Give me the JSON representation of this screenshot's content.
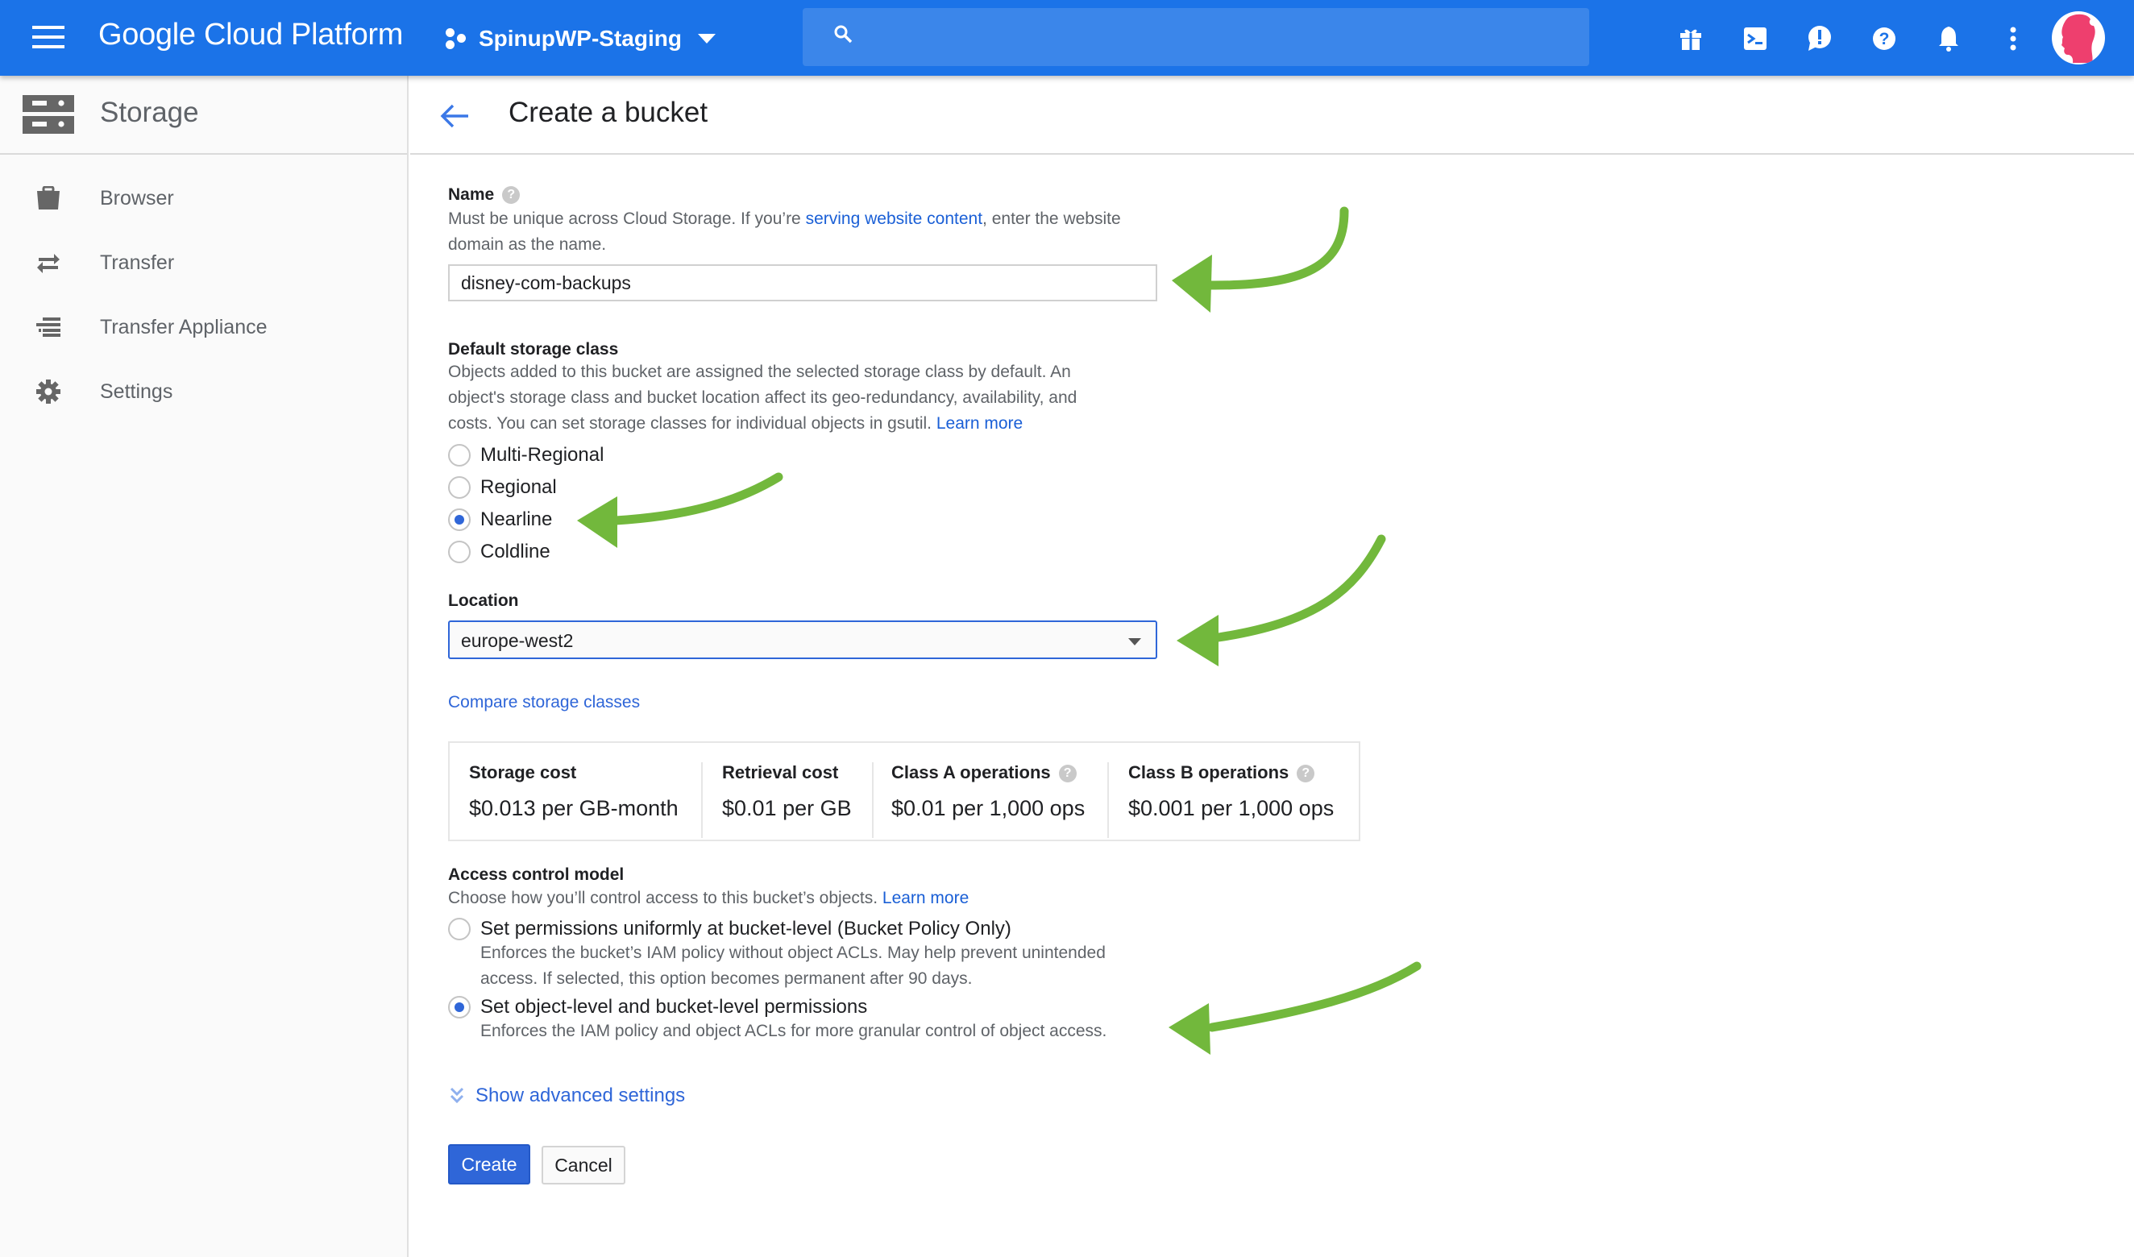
{
  "topbar": {
    "brand": "Google Cloud Platform",
    "project": "SpinupWP-Staging",
    "search_placeholder": "",
    "icons": [
      "gift-icon",
      "cloud-shell-icon",
      "feedback-icon",
      "help-icon",
      "notifications-icon",
      "more-vert-icon"
    ]
  },
  "sidebar": {
    "title": "Storage",
    "items": [
      {
        "label": "Browser",
        "icon": "bucket-icon"
      },
      {
        "label": "Transfer",
        "icon": "swap-arrows-icon"
      },
      {
        "label": "Transfer Appliance",
        "icon": "list-icon"
      },
      {
        "label": "Settings",
        "icon": "gear-icon"
      }
    ]
  },
  "header": {
    "title": "Create a bucket"
  },
  "form": {
    "name": {
      "label": "Name",
      "desc_pre": "Must be unique across Cloud Storage. If you’re ",
      "desc_link": "serving website content",
      "desc_post": ", enter the website",
      "desc_line2": "domain as the name.",
      "value": "disney-com-backups"
    },
    "storage_class": {
      "label": "Default storage class",
      "desc_line1": "Objects added to this bucket are assigned the selected storage class by default. An",
      "desc_line2": "object's storage class and bucket location affect its geo-redundancy, availability, and",
      "desc_line3": "costs. You can set storage classes for individual objects in gsutil. ",
      "learn_more": "Learn more",
      "options": [
        "Multi-Regional",
        "Regional",
        "Nearline",
        "Coldline"
      ],
      "selected": "Nearline"
    },
    "location": {
      "label": "Location",
      "value": "europe-west2"
    },
    "compare_link": "Compare storage classes",
    "pricing": [
      {
        "header": "Storage cost",
        "value": "$0.013 per GB-month",
        "help": false
      },
      {
        "header": "Retrieval cost",
        "value": "$0.01 per GB",
        "help": false
      },
      {
        "header": "Class A operations",
        "value": "$0.01 per 1,000 ops",
        "help": true
      },
      {
        "header": "Class B operations",
        "value": "$0.001 per 1,000 ops",
        "help": true
      }
    ],
    "access_control": {
      "label": "Access control model",
      "desc": "Choose how you’ll control access to this bucket’s objects. ",
      "learn_more": "Learn more",
      "options": [
        {
          "label": "Set permissions uniformly at bucket-level (Bucket Policy Only)",
          "desc_line1": "Enforces the bucket’s IAM policy without object ACLs. May help prevent unintended",
          "desc_line2": "access. If selected, this option becomes permanent after 90 days.",
          "selected": false
        },
        {
          "label": "Set object-level and bucket-level permissions",
          "desc_line1": "Enforces the IAM policy and object ACLs for more granular control of object access.",
          "selected": true
        }
      ]
    },
    "advanced_link": "Show advanced settings",
    "create_button": "Create",
    "cancel_button": "Cancel"
  },
  "colors": {
    "topbar": "#1b73e8",
    "accent": "#2f66d8",
    "annotation_arrow": "#72b83c"
  }
}
